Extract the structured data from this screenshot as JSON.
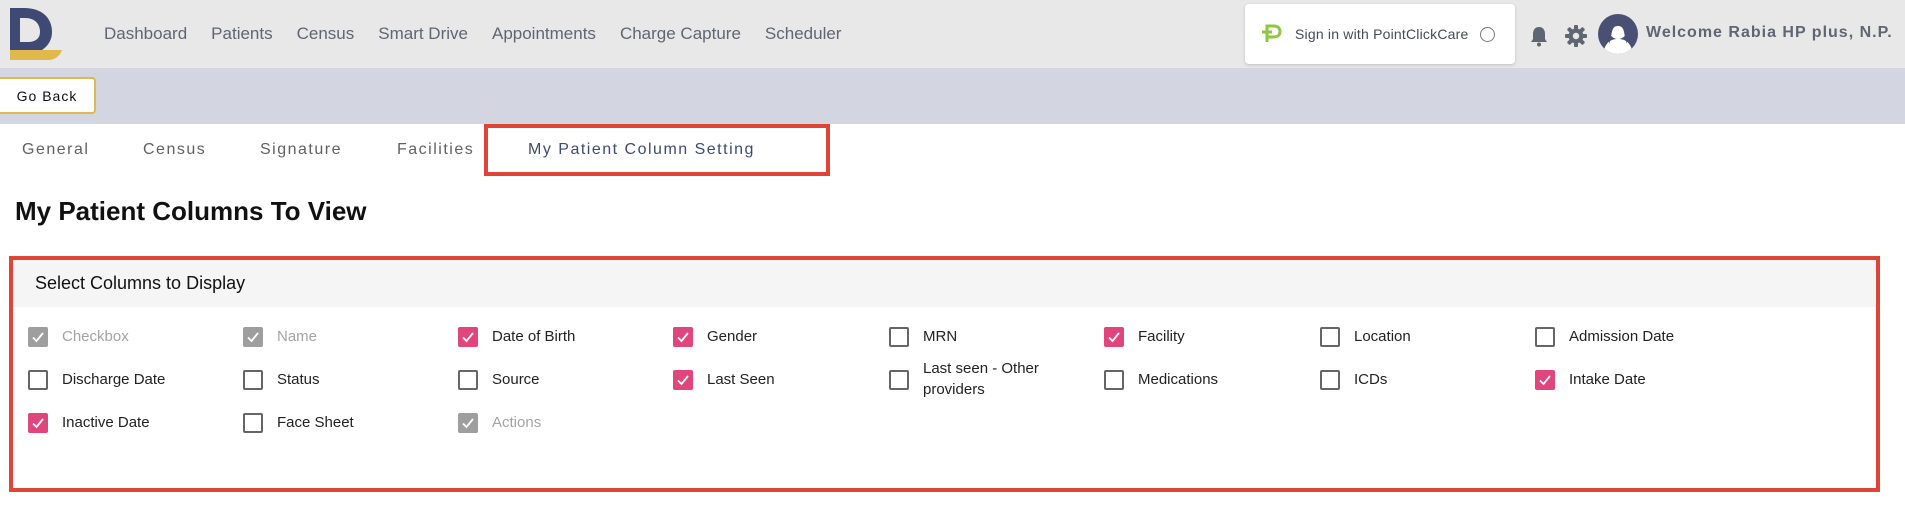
{
  "nav": {
    "items": [
      "Dashboard",
      "Patients",
      "Census",
      "Smart Drive",
      "Appointments",
      "Charge Capture",
      "Scheduler"
    ]
  },
  "pcc": {
    "label": "Sign in with PointClickCare"
  },
  "user": {
    "welcome": "Welcome Rabia HP plus, N.P."
  },
  "subbar": {
    "go_back_label": "Go Back"
  },
  "tabs": [
    {
      "label": "General",
      "active": false
    },
    {
      "label": "Census",
      "active": false
    },
    {
      "label": "Signature",
      "active": false
    },
    {
      "label": "Facilities",
      "active": false
    },
    {
      "label": "My Patient Column Setting",
      "active": true
    }
  ],
  "page": {
    "title": "My Patient Columns To View"
  },
  "columns_card": {
    "title": "Select Columns to Display",
    "options": [
      {
        "label": "Checkbox",
        "checked": true,
        "disabled": true
      },
      {
        "label": "Name",
        "checked": true,
        "disabled": true
      },
      {
        "label": "Date of Birth",
        "checked": true,
        "disabled": false
      },
      {
        "label": "Gender",
        "checked": true,
        "disabled": false
      },
      {
        "label": "MRN",
        "checked": false,
        "disabled": false
      },
      {
        "label": "Facility",
        "checked": true,
        "disabled": false
      },
      {
        "label": "Location",
        "checked": false,
        "disabled": false
      },
      {
        "label": "Admission Date",
        "checked": false,
        "disabled": false
      },
      {
        "label": "Discharge Date",
        "checked": false,
        "disabled": false
      },
      {
        "label": "Status",
        "checked": false,
        "disabled": false
      },
      {
        "label": "Source",
        "checked": false,
        "disabled": false
      },
      {
        "label": "Last Seen",
        "checked": true,
        "disabled": false
      },
      {
        "label": "Last seen - Other providers",
        "checked": false,
        "disabled": false
      },
      {
        "label": "Medications",
        "checked": false,
        "disabled": false
      },
      {
        "label": "ICDs",
        "checked": false,
        "disabled": false
      },
      {
        "label": "Intake Date",
        "checked": true,
        "disabled": false
      },
      {
        "label": "Inactive Date",
        "checked": true,
        "disabled": false
      },
      {
        "label": "Face Sheet",
        "checked": false,
        "disabled": false
      },
      {
        "label": "Actions",
        "checked": true,
        "disabled": true
      }
    ]
  },
  "colors": {
    "accent_pink": "#e0457b",
    "highlight_red": "#e04436",
    "brand_navy": "#3e4a73",
    "brand_gold": "#e0b84c",
    "pcc_green": "#8dc63f"
  },
  "icons": [
    "app-logo-icon",
    "pointclickcare-icon",
    "bell-icon",
    "gear-icon",
    "avatar-icon",
    "checkmark-icon"
  ]
}
